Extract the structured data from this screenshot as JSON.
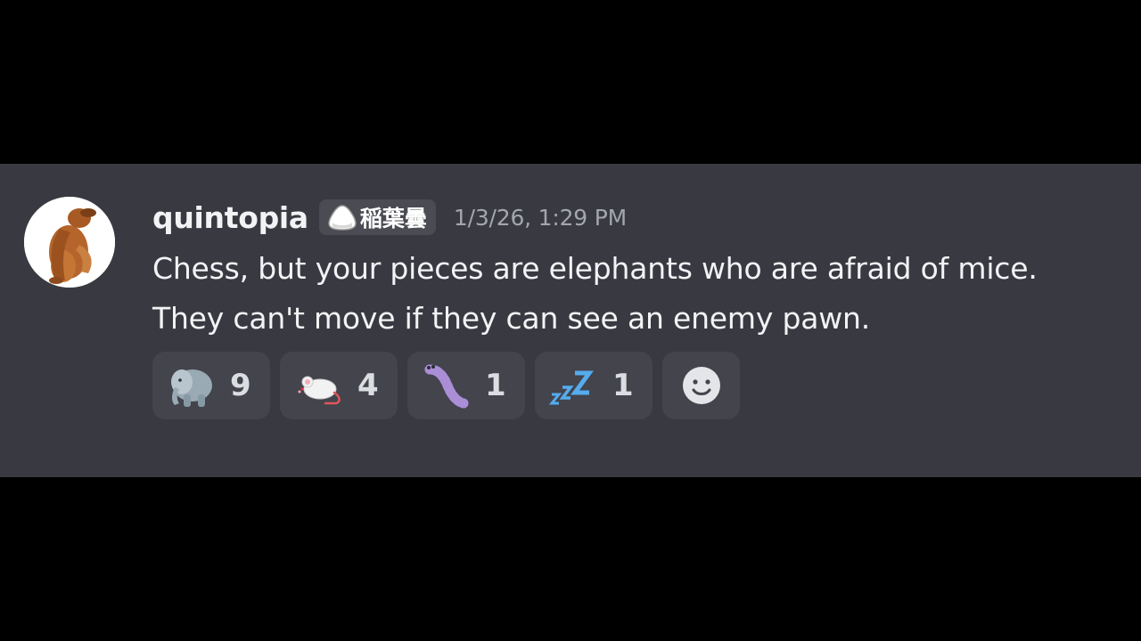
{
  "message": {
    "author": {
      "username": "quintopia",
      "avatar_icon": "golden-retriever-avatar",
      "server_tag": {
        "icon": "onigiri-icon",
        "text": "稲葉曇"
      }
    },
    "timestamp": "1/3/26, 1:29 PM",
    "lines": [
      "Chess, but your pieces are elephants who are afraid of mice.",
      "They can't move if they can see an enemy pawn."
    ],
    "reactions": [
      {
        "emoji": "elephant",
        "count": "9"
      },
      {
        "emoji": "mouse",
        "count": "4"
      },
      {
        "emoji": "worm",
        "count": "1"
      },
      {
        "emoji": "zzz",
        "count": "1"
      }
    ],
    "add_reaction_icon": "smiley-add-reaction-icon"
  },
  "colors": {
    "background": "#000000",
    "message_background": "#393a41",
    "reaction_background": "#43444c",
    "username": "#f2f3f5",
    "timestamp": "#a3a6ad"
  }
}
